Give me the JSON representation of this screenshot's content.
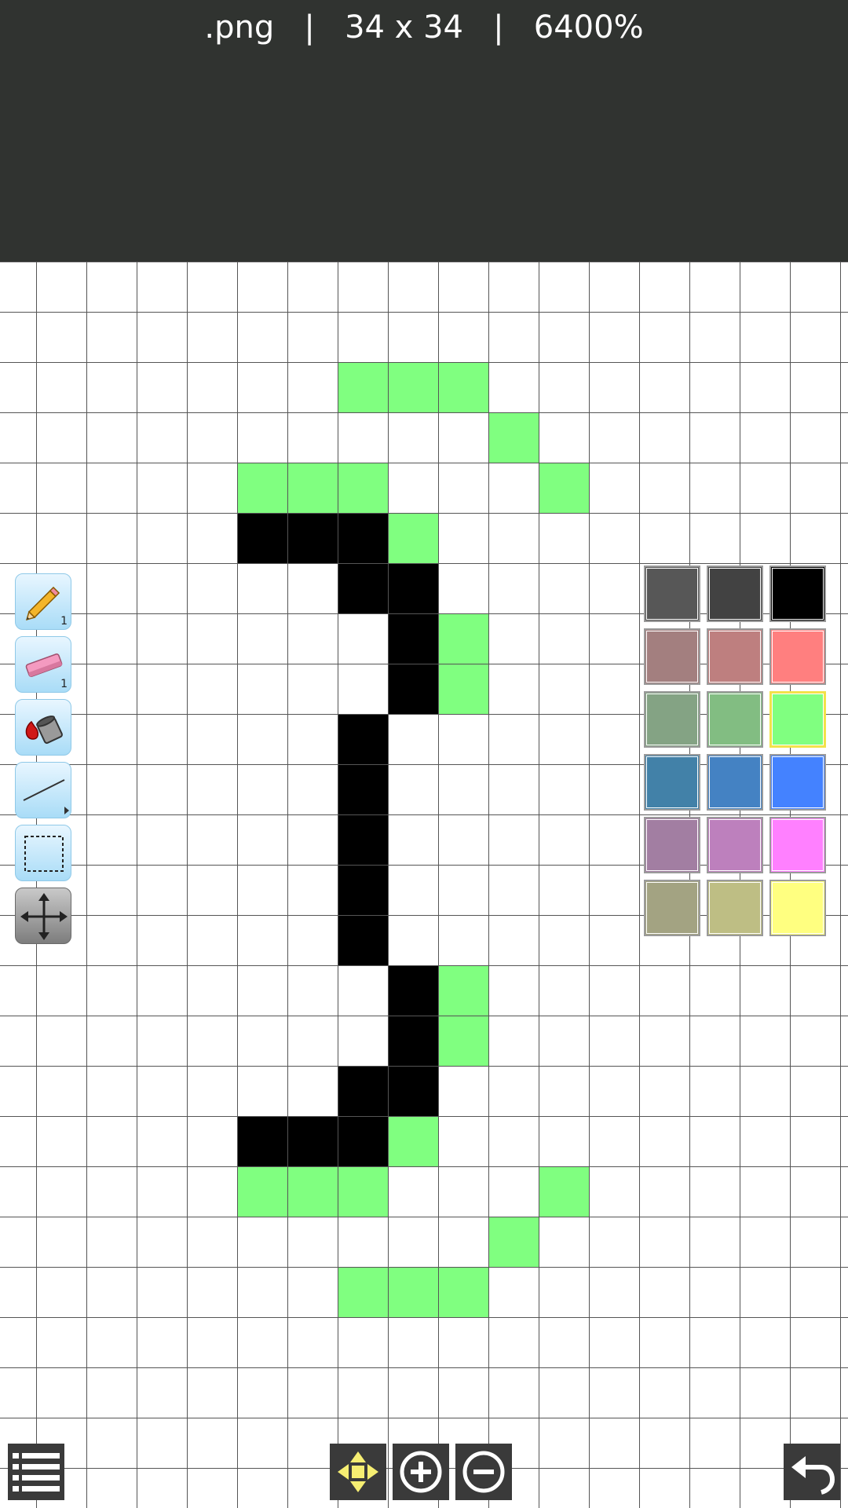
{
  "header": {
    "file_name": ".png",
    "separator": "|",
    "canvas_size": "34 x 34",
    "zoom": "6400%"
  },
  "canvas": {
    "grid_color": "#555555",
    "pixels": {
      "green": [
        [
          7,
          2
        ],
        [
          8,
          2
        ],
        [
          9,
          2
        ],
        [
          10,
          3
        ],
        [
          5,
          4
        ],
        [
          6,
          4
        ],
        [
          7,
          4
        ],
        [
          11,
          4
        ],
        [
          8,
          5
        ],
        [
          9,
          7
        ],
        [
          9,
          8
        ],
        [
          9,
          14
        ],
        [
          9,
          15
        ],
        [
          8,
          17
        ],
        [
          5,
          18
        ],
        [
          6,
          18
        ],
        [
          7,
          18
        ],
        [
          11,
          18
        ],
        [
          10,
          19
        ],
        [
          7,
          20
        ],
        [
          8,
          20
        ],
        [
          9,
          20
        ]
      ],
      "black": [
        [
          5,
          5
        ],
        [
          6,
          5
        ],
        [
          7,
          5
        ],
        [
          7,
          6
        ],
        [
          8,
          6
        ],
        [
          8,
          7
        ],
        [
          8,
          8
        ],
        [
          7,
          9
        ],
        [
          7,
          10
        ],
        [
          7,
          11
        ],
        [
          7,
          12
        ],
        [
          7,
          13
        ],
        [
          8,
          14
        ],
        [
          8,
          15
        ],
        [
          7,
          16
        ],
        [
          8,
          16
        ],
        [
          5,
          17
        ],
        [
          6,
          17
        ],
        [
          7,
          17
        ]
      ]
    }
  },
  "tools": [
    {
      "name": "pencil",
      "icon": "pencil-icon",
      "size_badge": "1"
    },
    {
      "name": "eraser",
      "icon": "eraser-icon",
      "size_badge": "1"
    },
    {
      "name": "fill",
      "icon": "paint-bucket-icon"
    },
    {
      "name": "line",
      "icon": "line-icon"
    },
    {
      "name": "select",
      "icon": "selection-rect-icon"
    },
    {
      "name": "move",
      "icon": "move-arrows-icon"
    }
  ],
  "palette": {
    "colors": [
      [
        "#575757",
        "#424242",
        "#000000"
      ],
      [
        "#a37f7f",
        "#be7f7f",
        "#ff7f7f"
      ],
      [
        "#84a384",
        "#82bd82",
        "#80ff80"
      ],
      [
        "#4281a8",
        "#4482c3",
        "#4482ff"
      ],
      [
        "#a27ea2",
        "#bd80bd",
        "#ff80ff"
      ],
      [
        "#a3a382",
        "#bebe84",
        "#ffff80"
      ]
    ],
    "selected": "#80ff80"
  },
  "bottom_bar": {
    "menu_icon": "list-menu-icon",
    "pan_icon": "pan-arrows-icon",
    "zoom_in_icon": "zoom-in-icon",
    "zoom_out_icon": "zoom-out-icon",
    "undo_icon": "undo-icon"
  }
}
